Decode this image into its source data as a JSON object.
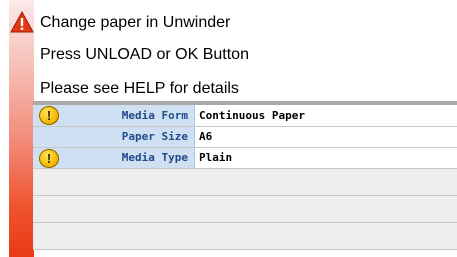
{
  "alert": {
    "icon": "warning-triangle-icon",
    "lines": [
      "Change paper in Unwinder",
      "Press UNLOAD or OK Button",
      "Please see HELP for details"
    ]
  },
  "settings": [
    {
      "label": "Media Form",
      "value": "Continuous Paper",
      "has_alert": true
    },
    {
      "label": "Paper Size",
      "value": "A6",
      "has_alert": false
    },
    {
      "label": "Media Type",
      "value": "Plain",
      "has_alert": true
    }
  ],
  "alert_icon_glyph": "!",
  "colors": {
    "alert_red": "#ea3a14",
    "label_blue": "#214b8a",
    "label_bg": "#cfe0f2"
  }
}
